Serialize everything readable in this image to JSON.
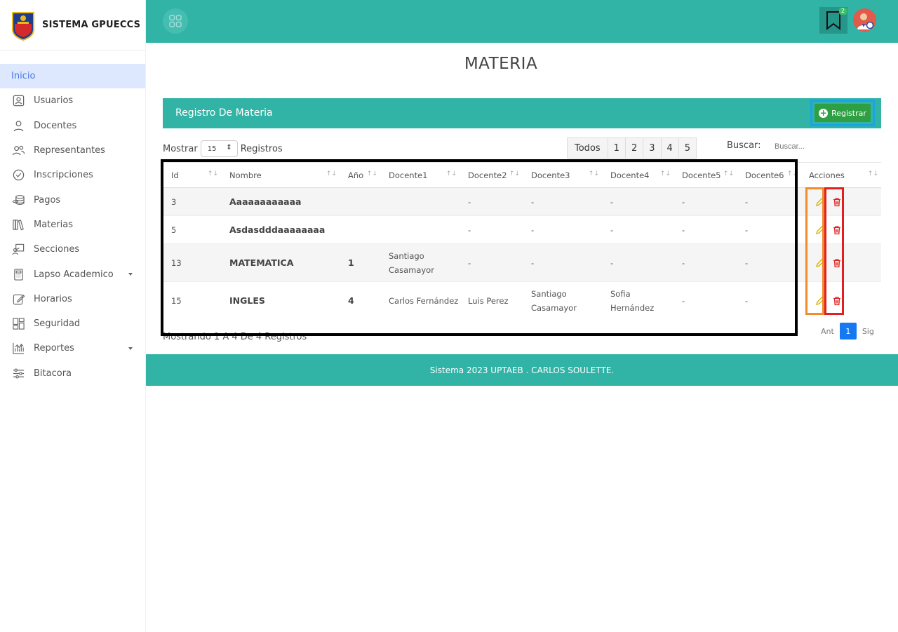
{
  "brand": {
    "title": "SISTEMA GPUECCS"
  },
  "sidebar": {
    "items": [
      {
        "label": "Inicio",
        "icon": "home",
        "active": true
      },
      {
        "label": "Usuarios",
        "icon": "user-card-icon"
      },
      {
        "label": "Docentes",
        "icon": "person-icon"
      },
      {
        "label": "Representantes",
        "icon": "group-icon"
      },
      {
        "label": "Inscripciones",
        "icon": "check-circle-icon"
      },
      {
        "label": "Pagos",
        "icon": "coins-icon"
      },
      {
        "label": "Materias",
        "icon": "books-icon"
      },
      {
        "label": "Secciones",
        "icon": "classroom-icon"
      },
      {
        "label": "Lapso Academico",
        "icon": "calculator-icon",
        "dropdown": true
      },
      {
        "label": "Horarios",
        "icon": "edit-icon"
      },
      {
        "label": "Seguridad",
        "icon": "dashboard-icon"
      },
      {
        "label": "Reportes",
        "icon": "bar-chart-icon",
        "dropdown": true
      },
      {
        "label": "Bitacora",
        "icon": "sliders-icon"
      }
    ]
  },
  "topbar": {
    "notification_count": "2"
  },
  "page": {
    "title": "MATERIA"
  },
  "card": {
    "title": "Registro De Materia",
    "register_label": "Registrar"
  },
  "controls": {
    "show_label": "Mostrar",
    "page_size": "15",
    "records_label": "Registros",
    "page_buttons": [
      "Todos",
      "1",
      "2",
      "3",
      "4",
      "5"
    ],
    "search_label": "Buscar:",
    "search_placeholder": "Buscar..."
  },
  "table": {
    "columns": [
      "Id",
      "Nombre",
      "Año",
      "Docente1",
      "Docente2",
      "Docente3",
      "Docente4",
      "Docente5",
      "Docente6",
      "Acciones"
    ],
    "rows": [
      {
        "id": "3",
        "nombre": "Aaaaaaaaaaaa",
        "anio": "",
        "d1": "",
        "d2": "-",
        "d3": "-",
        "d4": "-",
        "d5": "-",
        "d6": "-"
      },
      {
        "id": "5",
        "nombre": "Asdasdddaaaaaaaa",
        "anio": "",
        "d1": "",
        "d2": "-",
        "d3": "-",
        "d4": "-",
        "d5": "-",
        "d6": "-"
      },
      {
        "id": "13",
        "nombre": "MATEMATICA",
        "anio": "1",
        "d1": "Santiago Casamayor",
        "d2": "-",
        "d3": "-",
        "d4": "-",
        "d5": "-",
        "d6": "-"
      },
      {
        "id": "15",
        "nombre": "INGLES",
        "anio": "4",
        "d1": "Carlos Fernández",
        "d2": "Luis Perez",
        "d3": "Santiago Casamayor",
        "d4": "Sofia Hernández",
        "d5": "-",
        "d6": "-"
      }
    ]
  },
  "footer_info": "Mostrando 1 A 4 De 4 Registros",
  "pagination": {
    "prev": "Ant",
    "current": "1",
    "next": "Sig"
  },
  "footer": {
    "text": "Sistema 2023 UPTAEB . CARLOS SOULETTE."
  },
  "colors": {
    "primary": "#31b3a6",
    "register": "#2ea043",
    "active_page": "#1479f2"
  }
}
